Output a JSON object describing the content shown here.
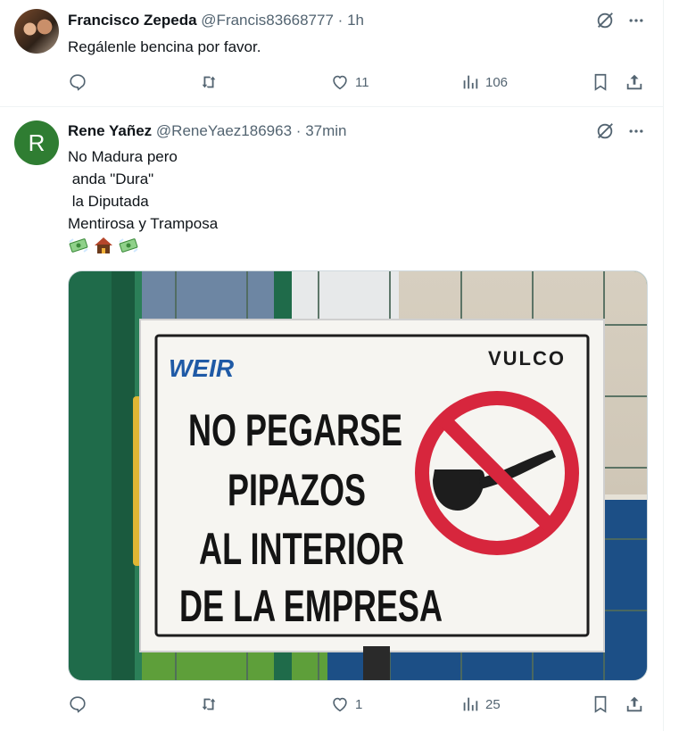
{
  "tweets": [
    {
      "name": "Francisco Zepeda",
      "handle": "@Francis83668777",
      "dot": "·",
      "time": "1h",
      "text": "Regálenle bencina por favor.",
      "actions": {
        "replies": "",
        "retweets": "",
        "likes": "11",
        "views": "106"
      }
    },
    {
      "name": "Rene Yañez",
      "handle": "@ReneYaez186963",
      "dot": "·",
      "time": "37min",
      "avatar_letter": "R",
      "text": "No Madura pero\n anda \"Dura\"\n la Diputada\nMentirosa y Tramposa",
      "actions": {
        "replies": "",
        "retweets": "",
        "likes": "1",
        "views": "25"
      },
      "media": {
        "brand_left": "WEIR",
        "brand_right": "VULCO",
        "sign_lines": [
          "NO PEGARSE",
          "PIPAZOS",
          "AL INTERIOR",
          "DE LA EMPRESA"
        ]
      }
    }
  ],
  "colors": {
    "text_primary": "#0f1419",
    "text_secondary": "#536471",
    "avatar_green": "#2f7d32",
    "sign_red": "#d7263d",
    "weir_blue": "#1f5aa6"
  }
}
